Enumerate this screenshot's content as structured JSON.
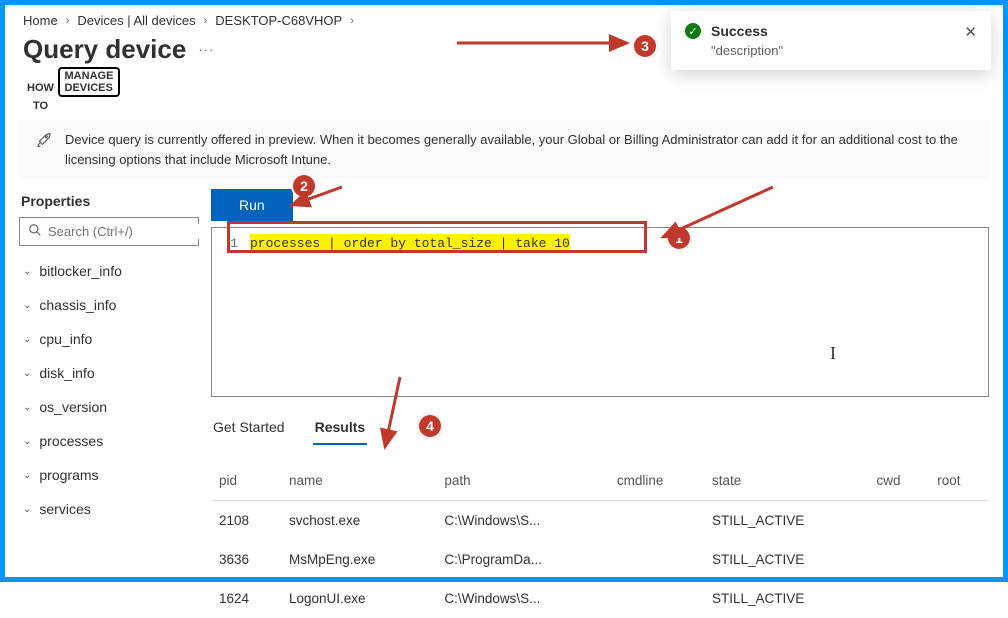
{
  "breadcrumb": [
    "Home",
    "Devices | All devices",
    "DESKTOP-C68VHOP"
  ],
  "page_title": "Query device",
  "logo": {
    "side1": "HOW",
    "side2": "TO",
    "box1": "MANAGE",
    "box2": "DEVICES"
  },
  "banner": "Device query is currently offered in preview. When it becomes generally available, your Global or Billing Administrator can add it for an additional cost to the licensing options that include Microsoft Intune.",
  "sidebar": {
    "header": "Properties",
    "search_placeholder": "Search (Ctrl+/)",
    "items": [
      "bitlocker_info",
      "chassis_info",
      "cpu_info",
      "disk_info",
      "os_version",
      "processes",
      "programs",
      "services"
    ]
  },
  "run_label": "Run",
  "query": {
    "line_no": "1",
    "text": "processes | order by total_size | take 10"
  },
  "tabs": {
    "get_started": "Get Started",
    "results": "Results"
  },
  "table": {
    "columns": [
      "pid",
      "name",
      "path",
      "cmdline",
      "state",
      "cwd",
      "root"
    ],
    "rows": [
      {
        "pid": "2108",
        "name": "svchost.exe",
        "path": "C:\\Windows\\S...",
        "cmdline": "",
        "state": "STILL_ACTIVE",
        "cwd": "",
        "root": ""
      },
      {
        "pid": "3636",
        "name": "MsMpEng.exe",
        "path": "C:\\ProgramDa...",
        "cmdline": "",
        "state": "STILL_ACTIVE",
        "cwd": "",
        "root": ""
      },
      {
        "pid": "1624",
        "name": "LogonUI.exe",
        "path": "C:\\Windows\\S...",
        "cmdline": "",
        "state": "STILL_ACTIVE",
        "cwd": "",
        "root": ""
      }
    ]
  },
  "toast": {
    "title": "Success",
    "desc": "\"description\""
  },
  "annotations": {
    "n1": "1",
    "n2": "2",
    "n3": "3",
    "n4": "4"
  }
}
